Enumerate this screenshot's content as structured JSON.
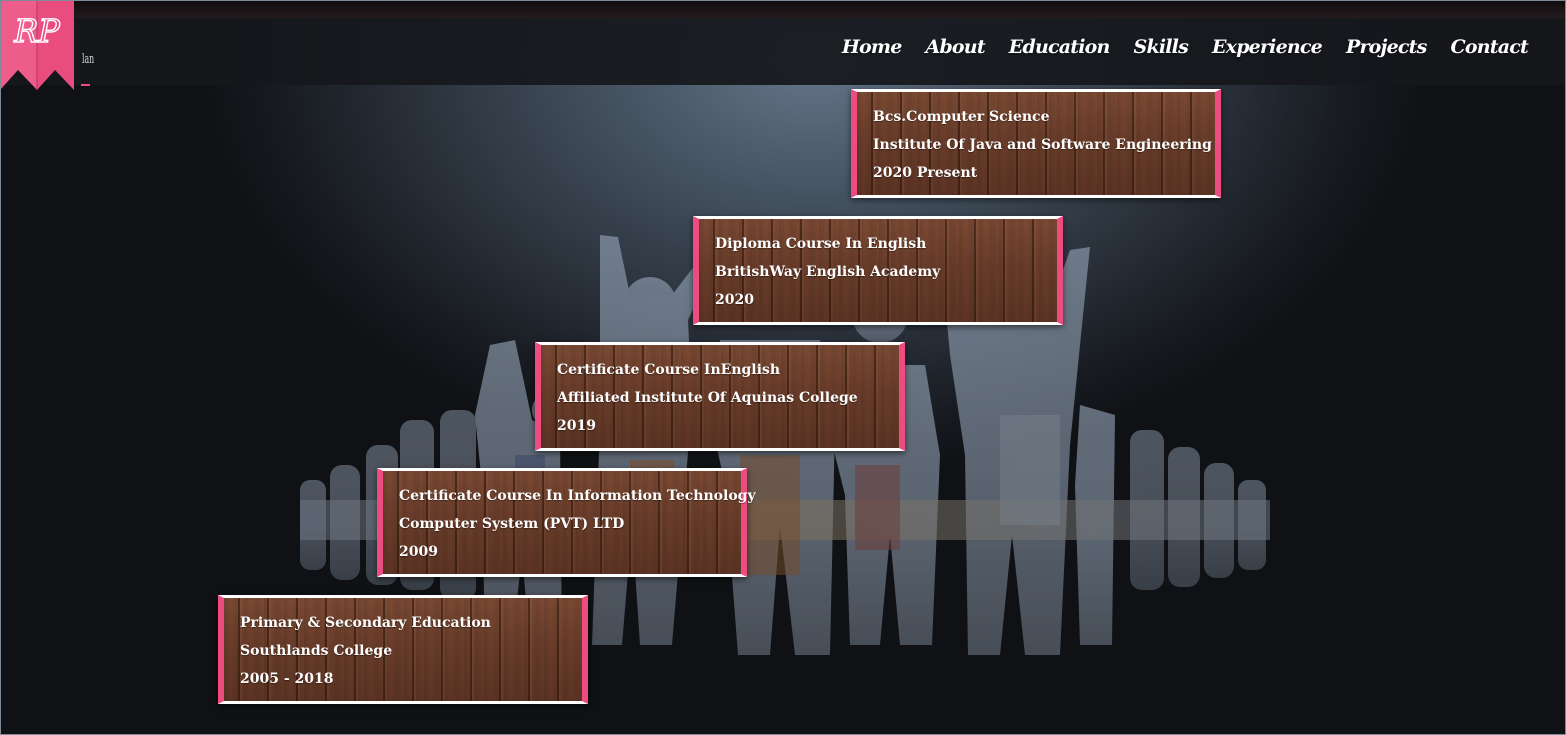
{
  "logo": {
    "monogram": "RP",
    "mark": "lan"
  },
  "nav": {
    "items": [
      "Home",
      "About",
      "Education",
      "Skills",
      "Experience",
      "Projects",
      "Contact"
    ]
  },
  "education": [
    {
      "degree": "Bcs.Computer Science",
      "institute": "Institute Of Java and Software Engineering",
      "years": "2020 Present"
    },
    {
      "degree": "Diploma Course In English",
      "institute": "BritishWay English Academy",
      "years": "2020"
    },
    {
      "degree": "Certificate Course InEnglish",
      "institute": "Affiliated Institute Of Aquinas College",
      "years": "2019"
    },
    {
      "degree": "Certificate Course In Information Technology",
      "institute": "Computer System (PVT) LTD",
      "years": "2009"
    },
    {
      "degree": "Primary & Secondary Education",
      "institute": "Southlands College",
      "years": "2005 - 2018"
    }
  ],
  "colors": {
    "accent": "#ee4c81",
    "wood": "#6a3d2a",
    "navbar": "#16181c"
  },
  "background_icon": "celebrating-people-silhouette-icon"
}
